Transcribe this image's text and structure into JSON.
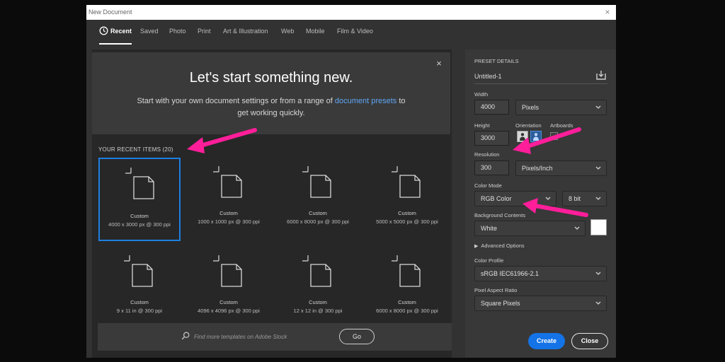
{
  "window": {
    "title": "New Document",
    "close_glyph": "×"
  },
  "tabs": [
    {
      "label": "Recent",
      "active": true,
      "icon": "clock-icon"
    },
    {
      "label": "Saved"
    },
    {
      "label": "Photo"
    },
    {
      "label": "Print"
    },
    {
      "label": "Art & Illustration"
    },
    {
      "label": "Web"
    },
    {
      "label": "Mobile"
    },
    {
      "label": "Film & Video"
    }
  ],
  "banner": {
    "heading": "Let's start something new.",
    "text_before": "Start with your own document settings or from a range of ",
    "link": "document presets",
    "text_after": " to get working quickly.",
    "close_glyph": "×"
  },
  "recent": {
    "label": "YOUR RECENT ITEMS  (20)",
    "items": [
      {
        "name": "Custom",
        "size": "4000 x 3000 px @ 300 ppi",
        "selected": true
      },
      {
        "name": "Custom",
        "size": "1000 x 1000 px @ 300 ppi"
      },
      {
        "name": "Custom",
        "size": "6000 x 8000 px @ 300 ppi"
      },
      {
        "name": "Custom",
        "size": "5000 x 5000 px @ 300 ppi"
      },
      {
        "name": "Custom",
        "size": "9 x 11 in @ 300 ppi"
      },
      {
        "name": "Custom",
        "size": "4096 x 4096 px @ 300 ppi"
      },
      {
        "name": "Custom",
        "size": "12 x 12 in @ 300 ppi"
      },
      {
        "name": "Custom",
        "size": "6000 x 8000 px @ 300 ppi"
      }
    ]
  },
  "search": {
    "placeholder": "Find more templates on Adobe Stock",
    "go_label": "Go"
  },
  "preset": {
    "section_label": "PRESET DETAILS",
    "title": "Untitled-1",
    "width_label": "Width",
    "width_value": "4000",
    "width_unit": "Pixels",
    "height_label": "Height",
    "height_value": "3000",
    "orientation_label": "Orientation",
    "artboards_label": "Artboards",
    "resolution_label": "Resolution",
    "resolution_value": "300",
    "resolution_unit": "Pixels/Inch",
    "color_mode_label": "Color Mode",
    "color_mode": "RGB Color",
    "bit_depth": "8 bit",
    "background_label": "Background Contents",
    "background": "White",
    "background_swatch": "#ffffff",
    "advanced_label": "Advanced Options",
    "color_profile_label": "Color Profile",
    "color_profile": "sRGB IEC61966-2.1",
    "pixel_aspect_label": "Pixel Aspect Ratio",
    "pixel_aspect": "Square Pixels"
  },
  "buttons": {
    "create": "Create",
    "close": "Close"
  },
  "colors": {
    "accent": "#1473e6",
    "annotation": "#ff1e9a",
    "selection": "#1e7fe0"
  }
}
